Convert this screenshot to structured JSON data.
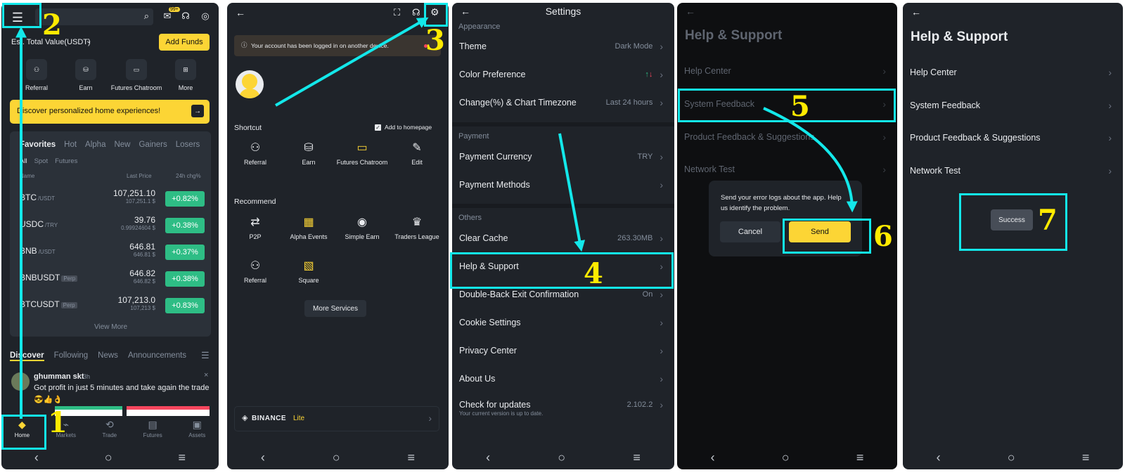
{
  "colors": {
    "accent": "#fcd535",
    "bg": "#1f2329",
    "green": "#2ebd85",
    "annot": "#13e8ea",
    "step": "#ffea00"
  },
  "p1": {
    "search_badge": "99+",
    "total_value": "Est. Total Value(USDT)",
    "add_funds": "Add Funds",
    "quick": [
      {
        "icon": "referral-icon",
        "label": "Referral"
      },
      {
        "icon": "earn-icon",
        "label": "Earn"
      },
      {
        "icon": "futures-chatroom-icon",
        "label": "Futures Chatroom"
      },
      {
        "icon": "more-icon",
        "label": "More"
      }
    ],
    "banner": "Discover personalized home experiences!",
    "tabs": [
      "Favorites",
      "Hot",
      "Alpha",
      "New",
      "Gainers",
      "Losers"
    ],
    "subtabs": [
      "All",
      "Spot",
      "Futures"
    ],
    "cols": [
      "Name",
      "Last Price",
      "24h chg%"
    ],
    "rows": [
      {
        "sym": "BTC",
        "quote": "/USDT",
        "price": "107,251.10",
        "sub": "107,251.1 $",
        "chg": "+0.82%"
      },
      {
        "sym": "USDC",
        "quote": "/TRY",
        "price": "39.76",
        "sub": "0.99924604 $",
        "chg": "+0.38%"
      },
      {
        "sym": "BNB",
        "quote": "/USDT",
        "price": "646.81",
        "sub": "646.81 $",
        "chg": "+0.37%"
      },
      {
        "sym": "BNBUSDT",
        "quote": "Perp",
        "price": "646.82",
        "sub": "646.82 $",
        "chg": "+0.38%"
      },
      {
        "sym": "BTCUSDT",
        "quote": "Perp",
        "price": "107,213.0",
        "sub": "107,213 $",
        "chg": "+0.83%"
      }
    ],
    "view_more": "View More",
    "feed_tabs": [
      "Discover",
      "Following",
      "News",
      "Announcements"
    ],
    "post_user": "ghumman skt",
    "post_time": "3h",
    "post_text": "Got profit in just 5 minutes and take again the trade",
    "post_emoji": "😎👍👌",
    "bottom_nav": [
      {
        "icon": "home-icon",
        "label": "Home"
      },
      {
        "icon": "markets-icon",
        "label": "Markets"
      },
      {
        "icon": "trade-icon",
        "label": "Trade"
      },
      {
        "icon": "futures-icon",
        "label": "Futures"
      },
      {
        "icon": "assets-icon",
        "label": "Assets"
      }
    ]
  },
  "p2": {
    "notice": "Your account has been logged in on another device.",
    "shortcut": "Shortcut",
    "add_home": "Add to homepage",
    "shortcuts": [
      "Referral",
      "Earn",
      "Futures Chatroom",
      "Edit"
    ],
    "recommend": "Recommend",
    "recommends": [
      "P2P",
      "Alpha Events",
      "Simple Earn",
      "Traders League",
      "Referral",
      "Square"
    ],
    "more_services": "More Services",
    "lite_brand": "BINANCE",
    "lite_word": "Lite"
  },
  "p3": {
    "title": "Settings",
    "appearance": "Appearance",
    "theme": "Theme",
    "theme_val": "Dark Mode",
    "color_pref": "Color Preference",
    "change_tz": "Change(%) & Chart Timezone",
    "change_tz_val": "Last 24 hours",
    "payment": "Payment",
    "pay_cur": "Payment Currency",
    "pay_cur_val": "TRY",
    "pay_methods": "Payment Methods",
    "others": "Others",
    "clear_cache": "Clear Cache",
    "clear_cache_val": "263.30MB",
    "help": "Help & Support",
    "double_back": "Double-Back Exit Confirmation",
    "double_back_val": "On",
    "cookie": "Cookie Settings",
    "privacy": "Privacy Center",
    "about": "About Us",
    "updates": "Check for updates",
    "updates_val": "2.102.2",
    "updates_sub": "Your current version is up to date."
  },
  "p4": {
    "title": "Help & Support",
    "items": [
      "Help Center",
      "System Feedback",
      "Product Feedback & Suggestions",
      "Network Test"
    ],
    "dialog_text": "Send your error logs about the app. Help us identify the problem.",
    "cancel": "Cancel",
    "send": "Send"
  },
  "p5": {
    "title": "Help & Support",
    "items": [
      "Help Center",
      "System Feedback",
      "Product Feedback & Suggestions",
      "Network Test"
    ],
    "toast": "Success"
  },
  "steps": [
    "1",
    "2",
    "3",
    "4",
    "5",
    "6",
    "7"
  ]
}
